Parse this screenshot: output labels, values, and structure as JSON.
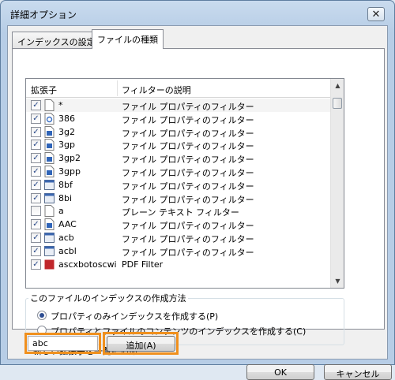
{
  "window": {
    "title": "詳細オプション",
    "close_label": "✕"
  },
  "tabs": [
    {
      "label": "インデックスの設定"
    },
    {
      "label": "ファイルの種類"
    }
  ],
  "list": {
    "columns": [
      "拡張子",
      "フィルターの説明"
    ],
    "rows": [
      {
        "checked": true,
        "icon": "blank-file-icon",
        "ext": "*",
        "desc": "ファイル プロパティのフィルター"
      },
      {
        "checked": true,
        "icon": "shortcut-file-icon",
        "ext": "386",
        "desc": "ファイル プロパティのフィルター"
      },
      {
        "checked": true,
        "icon": "video-file-icon",
        "ext": "3g2",
        "desc": "ファイル プロパティのフィルター"
      },
      {
        "checked": true,
        "icon": "video-file-icon",
        "ext": "3gp",
        "desc": "ファイル プロパティのフィルター"
      },
      {
        "checked": true,
        "icon": "video-file-icon",
        "ext": "3gp2",
        "desc": "ファイル プロパティのフィルター"
      },
      {
        "checked": true,
        "icon": "video-file-icon",
        "ext": "3gpp",
        "desc": "ファイル プロパティのフィルター"
      },
      {
        "checked": true,
        "icon": "window-file-icon",
        "ext": "8bf",
        "desc": "ファイル プロパティのフィルター"
      },
      {
        "checked": true,
        "icon": "window-file-icon",
        "ext": "8bi",
        "desc": "ファイル プロパティのフィルター"
      },
      {
        "checked": false,
        "icon": "blank-file-icon",
        "ext": "a",
        "desc": "プレーン テキスト フィルター"
      },
      {
        "checked": true,
        "icon": "audio-file-icon",
        "ext": "AAC",
        "desc": "ファイル プロパティのフィルター"
      },
      {
        "checked": true,
        "icon": "window-file-icon",
        "ext": "acb",
        "desc": "ファイル プロパティのフィルター"
      },
      {
        "checked": true,
        "icon": "window-file-icon",
        "ext": "acbl",
        "desc": "ファイル プロパティのフィルター"
      },
      {
        "checked": true,
        "icon": "pdf-file-icon",
        "ext": "ascxbotoscwi",
        "desc": "PDF Filter"
      }
    ]
  },
  "index_method": {
    "label": "このファイルのインデックスの作成方法",
    "options": [
      {
        "label": "プロパティのみインデックスを作成する(P)",
        "selected": true
      },
      {
        "label": "プロパティとファイルのコンテンツのインデックスを作成する(C)",
        "selected": false
      }
    ]
  },
  "add_extension": {
    "label": "新しい拡張子を一覧に追加:",
    "value": "abc",
    "button_label": "追加(A)"
  },
  "footer": {
    "ok_label": "OK",
    "cancel_label": "キャンセル"
  },
  "colors": {
    "highlight": "#f0901e",
    "radio_dot": "#2d4d92"
  }
}
